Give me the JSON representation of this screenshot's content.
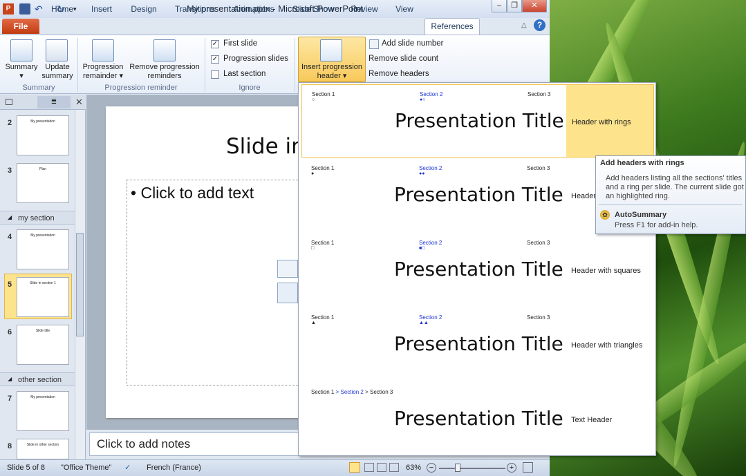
{
  "window": {
    "title": "My presentation.pptx - Microsoft PowerPoint"
  },
  "ribbon_tabs": [
    "File",
    "Home",
    "Insert",
    "Design",
    "Transitions",
    "Animations",
    "Slide Show",
    "Review",
    "View",
    "References"
  ],
  "ribbon": {
    "summary_group": {
      "label": "Summary",
      "summary": "Summary",
      "update_summary": "Update summary"
    },
    "progression_group": {
      "label": "Progression reminder",
      "progression_remainder": "Progression remainder",
      "remove_reminders": "Remove progression reminders"
    },
    "ignore_group": {
      "label": "Ignore",
      "first_slide": "First slide",
      "progression_slides": "Progression slides",
      "last_section": "Last section"
    },
    "insert_header": "Insert progression header",
    "add_slide_number": "Add slide number",
    "remove_slide_count": "Remove slide count",
    "remove_headers": "Remove headers"
  },
  "slides_panel": {
    "sections": [
      "my section",
      "other section"
    ],
    "slides": [
      {
        "num": "2",
        "title": "My presentation"
      },
      {
        "num": "3",
        "title": "Plan"
      },
      {
        "num": "4",
        "title": "My presentation"
      },
      {
        "num": "5",
        "title": "Slide in section 1"
      },
      {
        "num": "6",
        "title": "Slide title"
      },
      {
        "num": "7",
        "title": "My presentation"
      },
      {
        "num": "8",
        "title": "Slide in other section"
      }
    ]
  },
  "editor": {
    "slide_title": "Slide in",
    "body_placeholder": "Click to add text",
    "notes_placeholder": "Click to add notes"
  },
  "gallery": {
    "items": [
      {
        "sec1": "Section 1",
        "sec2": "Section 2",
        "sec3": "Section 3",
        "title": "Presentation Title",
        "label": "Header with rings"
      },
      {
        "sec1": "Section 1",
        "sec2": "Section 2",
        "sec3": "Section 3",
        "title": "Presentation Title",
        "label": "Header"
      },
      {
        "sec1": "Section 1",
        "sec2": "Section 2",
        "sec3": "Section 3",
        "title": "Presentation Title",
        "label": "Header with squares"
      },
      {
        "sec1": "Section 1",
        "sec2": "Section 2",
        "sec3": "Section 3",
        "title": "Presentation Title",
        "label": "Header with triangles"
      },
      {
        "sec1": "Section 1",
        "sec2": "Section 2",
        "sec3": "Section 3",
        "title": "Presentation Title",
        "label": "Text Header"
      }
    ],
    "breadcrumb_sep": ">"
  },
  "tooltip": {
    "title": "Add headers with rings",
    "body": "Add headers listing all the sections' titles and a ring per slide. The current slide got an highlighted ring.",
    "addin": "AutoSummary",
    "help": "Press F1 for add-in help."
  },
  "status": {
    "slide": "Slide 5 of 8",
    "theme": "\"Office Theme\"",
    "language": "French (France)",
    "zoom": "63%"
  },
  "colors": {
    "accent_blue": "#1a33d1",
    "hover_yellow": "#fde38c",
    "file_orange": "#c9431a"
  }
}
